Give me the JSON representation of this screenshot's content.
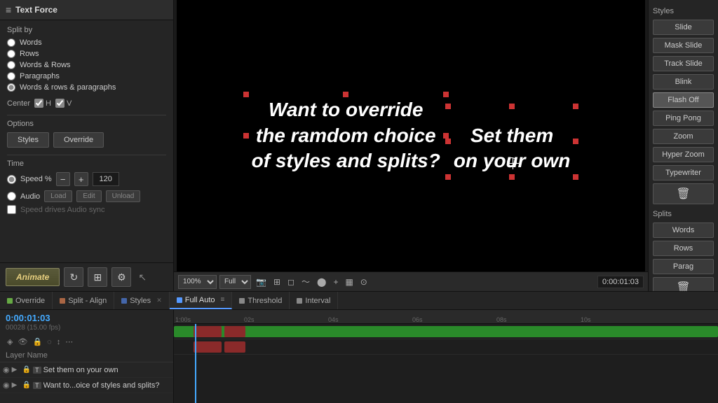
{
  "left_panel": {
    "title": "Text Force",
    "split_by_label": "Split by",
    "split_options": [
      {
        "id": "words",
        "label": "Words",
        "checked": false
      },
      {
        "id": "rows",
        "label": "Rows",
        "checked": false
      },
      {
        "id": "words_rows",
        "label": "Words & Rows",
        "checked": false
      },
      {
        "id": "paragraphs",
        "label": "Paragraphs",
        "checked": false
      },
      {
        "id": "words_rows_para",
        "label": "Words & rows & paragraphs",
        "checked": true
      }
    ],
    "center_label": "Center",
    "center_h": "H",
    "center_v": "V",
    "options_label": "Options",
    "styles_btn": "Styles",
    "override_btn": "Override",
    "time_label": "Time",
    "speed_label": "Speed %",
    "speed_value": "120",
    "audio_label": "Audio",
    "load_btn": "Load",
    "edit_btn": "Edit",
    "unload_btn": "Unload",
    "sync_label": "Speed drives Audio sync",
    "animate_btn": "Animate"
  },
  "preview": {
    "text_line1": "Want to override",
    "text_line2": "the ramdom choice",
    "text_line3": "of styles and splits?",
    "text_line4": "Set them",
    "text_line5": "on your own",
    "zoom": "100%",
    "quality": "Full",
    "time_display": "0:00:01:03"
  },
  "right_panel": {
    "styles_label": "Styles",
    "style_buttons": [
      {
        "label": "Slide",
        "active": false
      },
      {
        "label": "Mask Slide",
        "active": false
      },
      {
        "label": "Track Slide",
        "active": false
      },
      {
        "label": "Blink",
        "active": false
      },
      {
        "label": "Flash Off",
        "active": true
      },
      {
        "label": "Ping Pong",
        "active": false
      },
      {
        "label": "Zoom",
        "active": false
      },
      {
        "label": "Hyper Zoom",
        "active": false
      },
      {
        "label": "Typewriter",
        "active": false
      }
    ],
    "splits_label": "Splits",
    "split_buttons": [
      {
        "label": "Words",
        "active": false
      },
      {
        "label": "Rows",
        "active": false
      },
      {
        "label": "Parag",
        "active": false
      }
    ]
  },
  "timeline": {
    "tabs": [
      {
        "label": "Override",
        "color": "#6a4",
        "active": false
      },
      {
        "label": "Split - Align",
        "color": "#a64",
        "active": false
      },
      {
        "label": "Styles",
        "color": "#46a",
        "active": false,
        "closeable": true
      },
      {
        "label": "Full Auto",
        "color": "#5599ff",
        "active": true
      },
      {
        "label": "Threshold",
        "color": "#888",
        "active": false
      },
      {
        "label": "Interval",
        "color": "#888",
        "active": false
      }
    ],
    "timecode": "0:00:01:03",
    "frame_info": "00028 (15.00 fps)",
    "ruler_marks": [
      "1:00s",
      "02s",
      "04s",
      "06s",
      "08s",
      "10s"
    ],
    "layers": [
      {
        "name": "Set them on your own",
        "type": "T"
      },
      {
        "name": "Want to...oice of styles and splits?",
        "type": "T"
      }
    ],
    "layer_name_col": "Layer Name"
  }
}
